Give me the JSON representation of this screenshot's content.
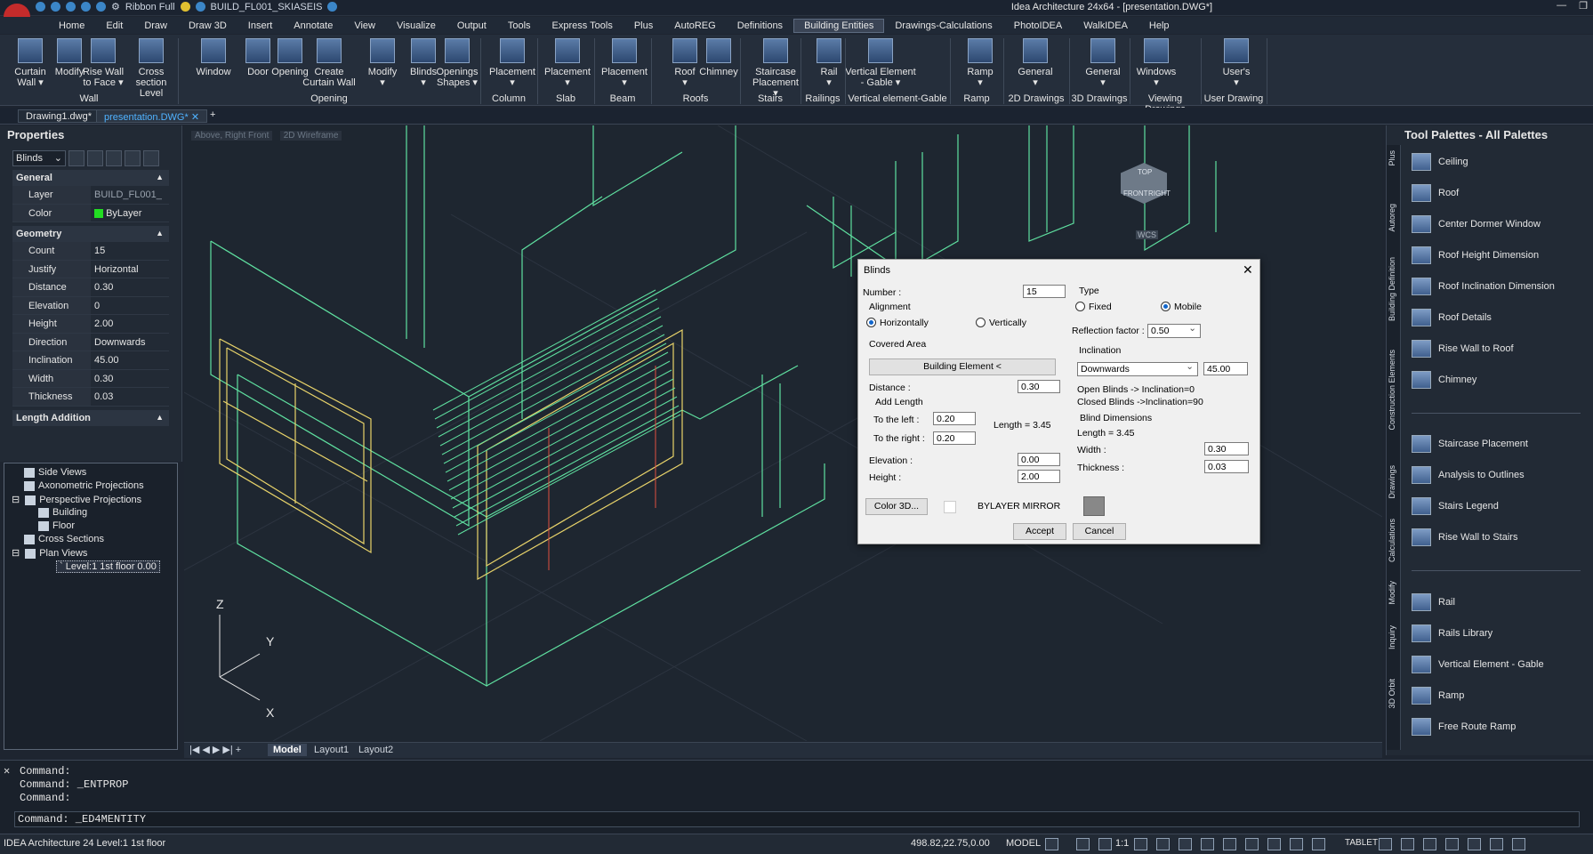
{
  "window": {
    "title": "Idea Architecture 24x64 - [presentation.DWG*]",
    "quick_access": {
      "workspace": "Ribbon Full",
      "file_name": "BUILD_FL001_SKIASEIS"
    }
  },
  "menu": [
    "Home",
    "Edit",
    "Draw",
    "Draw 3D",
    "Insert",
    "Annotate",
    "View",
    "Visualize",
    "Output",
    "Tools",
    "Express Tools",
    "Plus",
    "AutoREG",
    "Definitions",
    "Building Entities",
    "Drawings-Calculations",
    "PhotoIDEA",
    "WalkIDEA",
    "Help"
  ],
  "ribbon": {
    "tools": [
      {
        "l1": "Curtain",
        "l2": "Wall ▾"
      },
      {
        "l1": "Modify",
        "l2": ""
      },
      {
        "l1": "Rise Wall",
        "l2": "to Face ▾"
      },
      {
        "l1": "Cross",
        "l2": "section Level"
      },
      {
        "l1": "Window",
        "l2": ""
      },
      {
        "l1": "Door",
        "l2": ""
      },
      {
        "l1": "Opening",
        "l2": ""
      },
      {
        "l1": "Create",
        "l2": "Curtain Wall"
      },
      {
        "l1": "Modify",
        "l2": "▾"
      },
      {
        "l1": "Blinds",
        "l2": "▾"
      },
      {
        "l1": "Openings",
        "l2": "Shapes ▾"
      },
      {
        "l1": "Placement",
        "l2": "▾"
      },
      {
        "l1": "Placement",
        "l2": "▾"
      },
      {
        "l1": "Placement",
        "l2": "▾"
      },
      {
        "l1": "Roof",
        "l2": "▾"
      },
      {
        "l1": "Chimney",
        "l2": ""
      },
      {
        "l1": "Staircase",
        "l2": "Placement ▾"
      },
      {
        "l1": "Rail",
        "l2": "▾"
      },
      {
        "l1": "Vertical Element",
        "l2": "- Gable ▾"
      },
      {
        "l1": "Ramp",
        "l2": "▾"
      },
      {
        "l1": "General",
        "l2": "▾"
      },
      {
        "l1": "General",
        "l2": "▾"
      },
      {
        "l1": "Windows",
        "l2": "▾"
      },
      {
        "l1": "User's",
        "l2": "▾"
      }
    ],
    "groups": [
      "Wall",
      "Opening",
      "Column",
      "Slab",
      "Beam",
      "Roofs",
      "Stairs",
      "Railings",
      "Vertical element-Gable",
      "Ramp",
      "2D Drawings",
      "3D Drawings",
      "Viewing Drawings",
      "User Drawing"
    ]
  },
  "doc_tabs": [
    "Drawing1.dwg*",
    "presentation.DWG*"
  ],
  "properties": {
    "title": "Properties",
    "selector": "Blinds",
    "general_title": "General",
    "layer_label": "Layer",
    "layer_value": "BUILD_FL001_",
    "color_label": "Color",
    "color_value": "ByLayer",
    "geometry_title": "Geometry",
    "rows": [
      {
        "k": "Count",
        "v": "15"
      },
      {
        "k": "Justify",
        "v": "Horizontal"
      },
      {
        "k": "Distance",
        "v": "0.30"
      },
      {
        "k": "Elevation",
        "v": "0"
      },
      {
        "k": "Height",
        "v": "2.00"
      },
      {
        "k": "Direction",
        "v": "Downwards"
      },
      {
        "k": "Inclination",
        "v": "45.00"
      },
      {
        "k": "Width",
        "v": "0.30"
      },
      {
        "k": "Thickness",
        "v": "0.03"
      }
    ],
    "length_title": "Length Addition"
  },
  "tree": [
    "Side Views",
    "Axonometric Projections",
    "Perspective Projections",
    "Building",
    "Floor",
    "Cross Sections",
    "Plan Views",
    "` Level:1 1st floor 0.00"
  ],
  "viewport": {
    "label1": "Above, Right Front",
    "label2": "2D Wireframe",
    "cube_top": "TOP",
    "cube_front": "FRONT",
    "cube_right": "RIGHT",
    "wcs": "WCS",
    "axis_z": "Z",
    "axis_y": "Y",
    "axis_x": "X"
  },
  "view_tabs": [
    "Model",
    "Layout1",
    "Layout2"
  ],
  "dialog": {
    "title": "Blinds",
    "number_label": "Number :",
    "number_value": "15",
    "alignment_label": "Alignment",
    "horizontal": "Horizontally",
    "vertical": "Vertically",
    "covered_area": "Covered Area",
    "building_element_btn": "Building Element <",
    "distance_label": "Distance :",
    "distance_value": "0.30",
    "add_length": "Add Length",
    "left_label": "To the left :",
    "left_value": "0.20",
    "right_label": "To the right :",
    "right_value": "0.20",
    "length_text": "Length = 3.45",
    "elevation_label": "Elevation :",
    "elevation_value": "0.00",
    "height_label": "Height :",
    "height_value": "2.00",
    "type_label": "Type",
    "fixed": "Fixed",
    "mobile": "Mobile",
    "reflection_label": "Reflection factor :",
    "reflection_value": "0.50",
    "inclination_label": "Inclination",
    "direction_value": "Downwards",
    "inclination_value": "45.00",
    "open_note": "Open Blinds -> Inclination=0",
    "closed_note": "Closed Blinds ->Inclination=90",
    "blind_dims": "Blind Dimensions",
    "blind_length": "Length = 3.45",
    "width_label": "Width :",
    "width_value": "0.30",
    "thickness_label": "Thickness :",
    "thickness_value": "0.03",
    "color_btn": "Color 3D...",
    "bylayer_text": "BYLAYER MIRROR",
    "accept": "Accept",
    "cancel": "Cancel"
  },
  "palette": {
    "title": "Tool Palettes - All Palettes",
    "side_tabs": [
      "Plus",
      "Autoreg",
      "Building Definition",
      "Construction Elements",
      "Drawings",
      "Calculations",
      "Modify",
      "Inquiry",
      "3D Orbit"
    ],
    "items": [
      "Ceiling",
      "Roof",
      "Center Dormer Window",
      "Roof Height Dimension",
      "Roof Inclination Dimension",
      "Roof Details",
      "Rise Wall to Roof",
      "Chimney",
      "Staircase Placement",
      "Analysis to Outlines",
      "Stairs Legend",
      "Rise Wall to Stairs",
      "Rail",
      "Rails Library",
      "Vertical Element - Gable",
      "Ramp",
      "Free Route Ramp"
    ]
  },
  "command": {
    "lines": [
      "Command:",
      "Command: _ENTPROP",
      "Command:"
    ],
    "input": "Command: _ED4MENTITY"
  },
  "status": {
    "left": "IDEA Architecture 24 Level:1 1st floor",
    "coords": "498.82,22.75,0.00",
    "model": "MODEL",
    "scale": "1:1",
    "tablet": "TABLET"
  },
  "colors": {
    "accent": "#4fb2ff",
    "wire_green": "#5fe0a0",
    "wire_yellow": "#e8d36a"
  }
}
